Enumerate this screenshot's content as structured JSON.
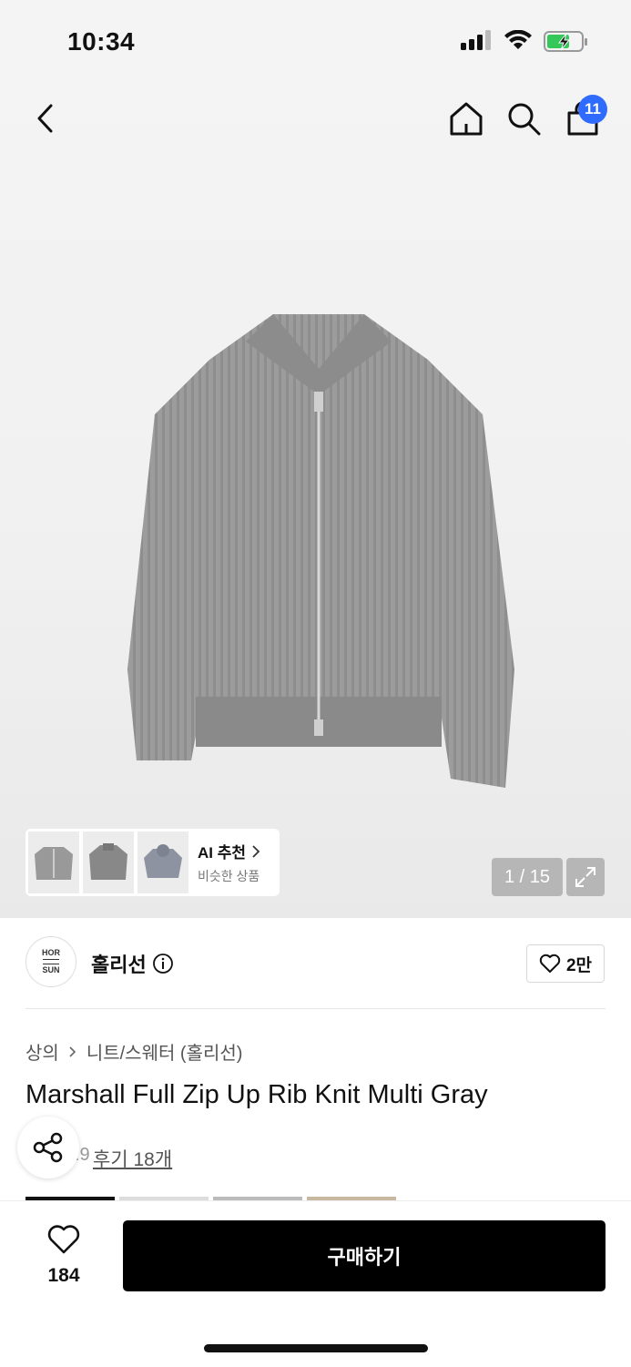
{
  "status": {
    "time": "10:34"
  },
  "header": {
    "cart_count": "11"
  },
  "gallery": {
    "ai_title": "AI 추천",
    "ai_subtitle": "비슷한 상품",
    "counter": "1 / 15"
  },
  "brand": {
    "name": "홀리선",
    "likes": "2만",
    "logo_top": "HOR",
    "logo_bottom": "SUN"
  },
  "product": {
    "breadcrumb": [
      "상의",
      "니트/스웨터 (홀리선)"
    ],
    "title": "Marshall Full Zip Up Rib Knit Multi Gray",
    "rating_partial": ".9",
    "review_link": "후기 18개"
  },
  "bottom_bar": {
    "wish_count": "184",
    "buy_label": "구매하기"
  },
  "colors": {
    "primary": "#000000",
    "badge": "#2f6bff",
    "battery": "#34c759"
  }
}
